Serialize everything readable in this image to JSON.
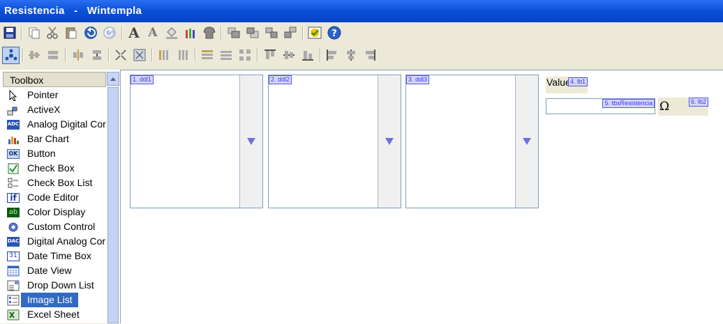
{
  "window": {
    "title": "Resistencia   -   Wintempla"
  },
  "toolbar1": {
    "icons": [
      "save-icon",
      "copy-icon",
      "cut-icon",
      "paste-icon",
      "undo-icon",
      "redo-icon",
      "font-icon",
      "font-color-icon",
      "fill-color-icon",
      "pencils-icon",
      "shirt-icon",
      "bring-front-icon",
      "send-back-icon",
      "group-icon",
      "ungroup-icon",
      "check-shield-icon",
      "help-icon"
    ],
    "font_glyph": "A"
  },
  "toolbar2": {
    "icons": [
      "tab-order-icon",
      "align-icons"
    ]
  },
  "toolbox": {
    "header": "Toolbox",
    "items": [
      {
        "label": "Pointer",
        "icon": "pointer-icon"
      },
      {
        "label": "ActiveX",
        "icon": "activex-icon"
      },
      {
        "label": "Analog Digital Cor",
        "icon": "adc-icon",
        "glyph": "ADC"
      },
      {
        "label": "Bar Chart",
        "icon": "bar-chart-icon"
      },
      {
        "label": "Button",
        "icon": "button-icon",
        "glyph": "OK"
      },
      {
        "label": "Check Box",
        "icon": "check-box-icon"
      },
      {
        "label": "Check Box List",
        "icon": "check-box-list-icon"
      },
      {
        "label": "Code Editor",
        "icon": "code-editor-icon",
        "glyph": "if"
      },
      {
        "label": "Color Display",
        "icon": "color-display-icon",
        "glyph": "ab"
      },
      {
        "label": "Custom Control",
        "icon": "custom-control-icon"
      },
      {
        "label": "Digital Analog Cor",
        "icon": "dac-icon",
        "glyph": "DAC"
      },
      {
        "label": "Date Time Box",
        "icon": "date-time-box-icon",
        "glyph": "31"
      },
      {
        "label": "Date View",
        "icon": "date-view-icon"
      },
      {
        "label": "Drop Down List",
        "icon": "drop-down-list-icon"
      },
      {
        "label": "Image List",
        "icon": "image-list-icon",
        "selected": true
      },
      {
        "label": "Excel Sheet",
        "icon": "excel-sheet-icon"
      }
    ]
  },
  "designer": {
    "dropdowns": [
      {
        "tag": "1. ddl1"
      },
      {
        "tag": "2. ddl2"
      },
      {
        "tag": "3. ddl3"
      }
    ],
    "label1": {
      "text": "Value",
      "tag": "4. lb1"
    },
    "textbox": {
      "tag": "5. tbxResistencia",
      "value": ""
    },
    "label2": {
      "text": "Ω",
      "tag": "6. lb2"
    }
  },
  "colors": {
    "title_bar": "#0a4fd8",
    "selection": "#316ac5",
    "tag_text": "#3a3acc",
    "dropdown_arrow": "#6f6fe0"
  }
}
